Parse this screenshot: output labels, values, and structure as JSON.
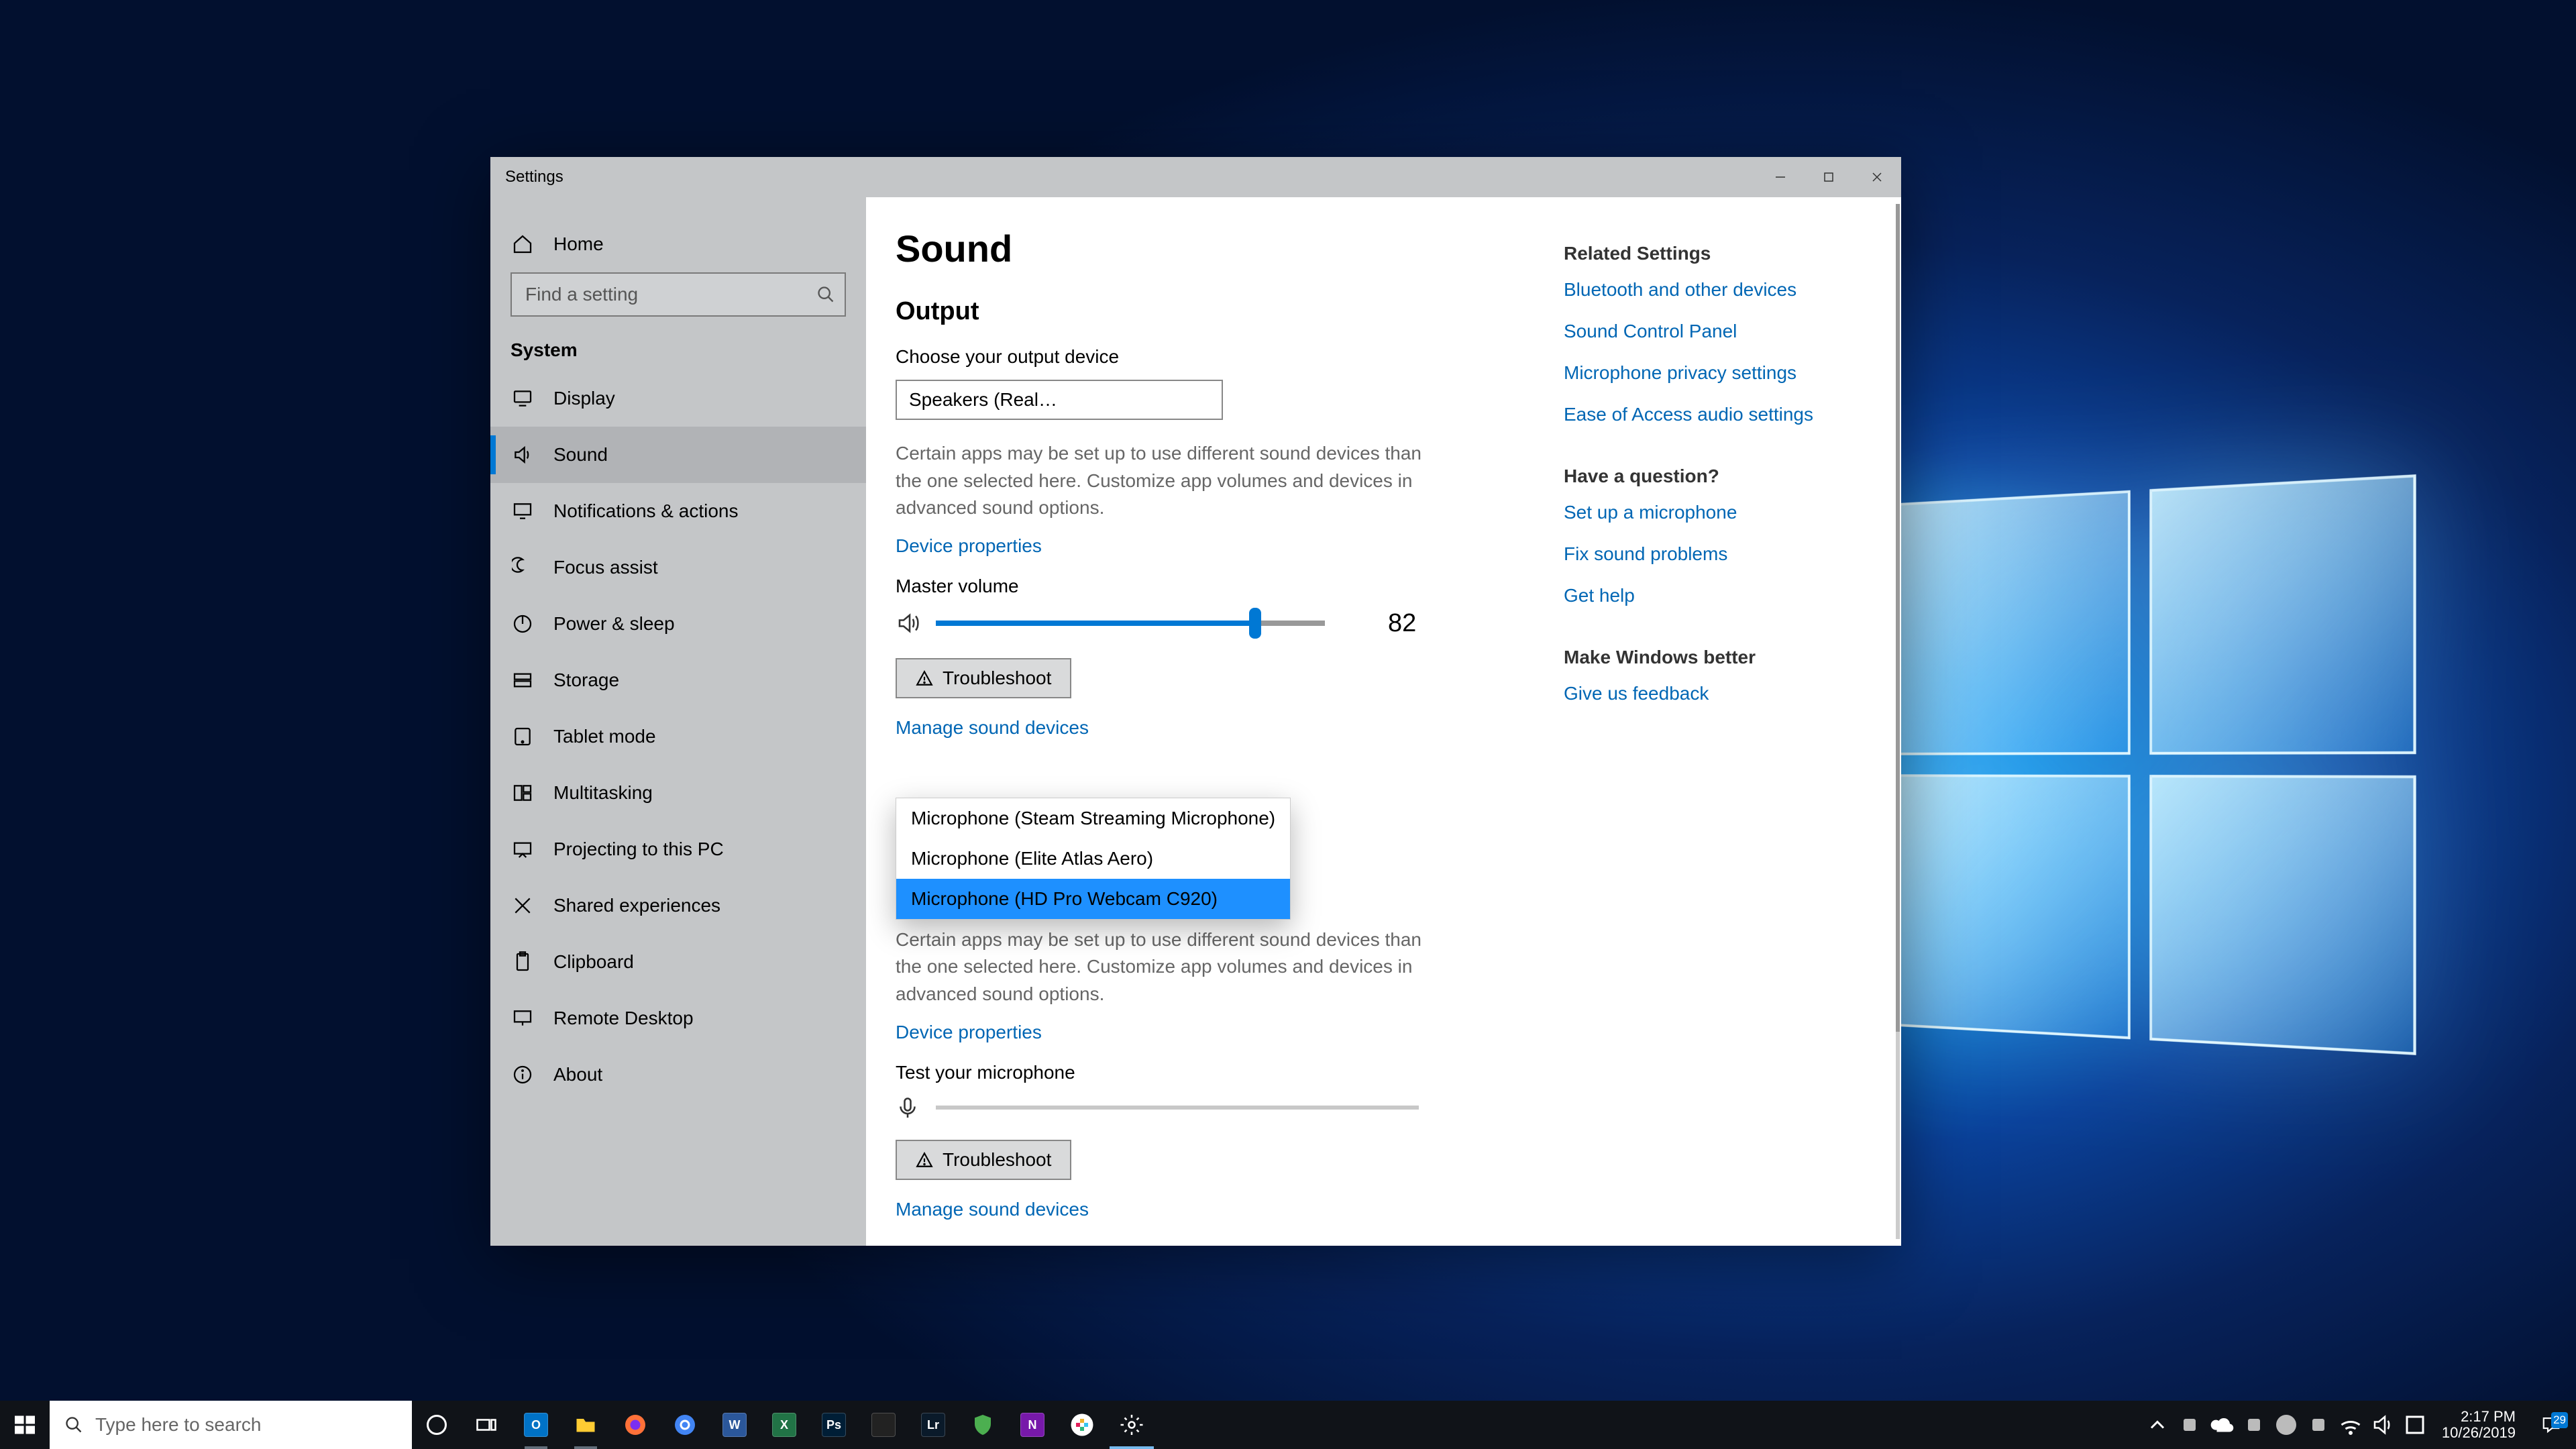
{
  "window": {
    "title": "Settings",
    "controls": {
      "min": "minimize",
      "max": "maximize",
      "close": "close"
    }
  },
  "sidebar": {
    "home": "Home",
    "search_placeholder": "Find a setting",
    "category": "System",
    "items": [
      {
        "id": "display",
        "label": "Display"
      },
      {
        "id": "sound",
        "label": "Sound"
      },
      {
        "id": "notifications",
        "label": "Notifications & actions"
      },
      {
        "id": "focus-assist",
        "label": "Focus assist"
      },
      {
        "id": "power-sleep",
        "label": "Power & sleep"
      },
      {
        "id": "storage",
        "label": "Storage"
      },
      {
        "id": "tablet-mode",
        "label": "Tablet mode"
      },
      {
        "id": "multitasking",
        "label": "Multitasking"
      },
      {
        "id": "projecting",
        "label": "Projecting to this PC"
      },
      {
        "id": "shared-exp",
        "label": "Shared experiences"
      },
      {
        "id": "clipboard",
        "label": "Clipboard"
      },
      {
        "id": "remote-desktop",
        "label": "Remote Desktop"
      },
      {
        "id": "about",
        "label": "About"
      }
    ],
    "active_id": "sound"
  },
  "page": {
    "title": "Sound",
    "output": {
      "heading": "Output",
      "choose_label": "Choose your output device",
      "selected_device": "Speakers (Realtek High Definition…",
      "help": "Certain apps may be set up to use different sound devices than the one selected here. Customize app volumes and devices in advanced sound options.",
      "device_properties": "Device properties",
      "master_volume_label": "Master volume",
      "master_volume_value": "82",
      "troubleshoot": "Troubleshoot",
      "manage": "Manage sound devices"
    },
    "input": {
      "dropdown_options": [
        "Microphone (Steam Streaming Microphone)",
        "Microphone (Elite Atlas Aero)",
        "Microphone (HD Pro Webcam C920)"
      ],
      "dropdown_selected_index": 2,
      "help": "Certain apps may be set up to use different sound devices than the one selected here. Customize app volumes and devices in advanced sound options.",
      "device_properties": "Device properties",
      "test_label": "Test your microphone",
      "troubleshoot": "Troubleshoot",
      "manage": "Manage sound devices"
    }
  },
  "rail": {
    "related_heading": "Related Settings",
    "related_links": [
      "Bluetooth and other devices",
      "Sound Control Panel",
      "Microphone privacy settings",
      "Ease of Access audio settings"
    ],
    "question_heading": "Have a question?",
    "question_links": [
      "Set up a microphone",
      "Fix sound problems",
      "Get help"
    ],
    "feedback_heading": "Make Windows better",
    "feedback_link": "Give us feedback"
  },
  "taskbar": {
    "search_placeholder": "Type here to search",
    "apps": [
      {
        "id": "cortana",
        "name": "cortana"
      },
      {
        "id": "taskview",
        "name": "task-view"
      },
      {
        "id": "outlook",
        "name": "outlook",
        "running": true,
        "bg": "#0072c6",
        "txt": "O"
      },
      {
        "id": "explorer",
        "name": "file-explorer",
        "running": true,
        "bg": "#ffcc33",
        "txt": ""
      },
      {
        "id": "firefox",
        "name": "firefox",
        "bg": "#ff7139",
        "txt": ""
      },
      {
        "id": "chrome",
        "name": "chrome",
        "bg": "",
        "txt": ""
      },
      {
        "id": "word",
        "name": "word",
        "bg": "#2b579a",
        "txt": "W"
      },
      {
        "id": "excel",
        "name": "excel",
        "bg": "#217346",
        "txt": "X"
      },
      {
        "id": "photoshop",
        "name": "photoshop",
        "bg": "#001e36",
        "txt": "Ps"
      },
      {
        "id": "app1",
        "name": "app",
        "bg": "#222",
        "txt": ""
      },
      {
        "id": "lightroom",
        "name": "lightroom",
        "bg": "#0a1a2a",
        "txt": "Lr"
      },
      {
        "id": "defender",
        "name": "defender",
        "bg": "",
        "txt": ""
      },
      {
        "id": "onenote",
        "name": "onenote",
        "bg": "#7719aa",
        "txt": "N"
      },
      {
        "id": "slack",
        "name": "slack",
        "bg": "#fff",
        "txt": ""
      },
      {
        "id": "settings",
        "name": "settings",
        "running": true,
        "active": true,
        "bg": "",
        "txt": ""
      }
    ],
    "tray_icons": [
      "chevron-up",
      "app",
      "onedrive",
      "app",
      "steam",
      "app",
      "network",
      "volume",
      "ime"
    ],
    "time": "2:17 PM",
    "date": "10/26/2019",
    "notif_count": "29"
  }
}
